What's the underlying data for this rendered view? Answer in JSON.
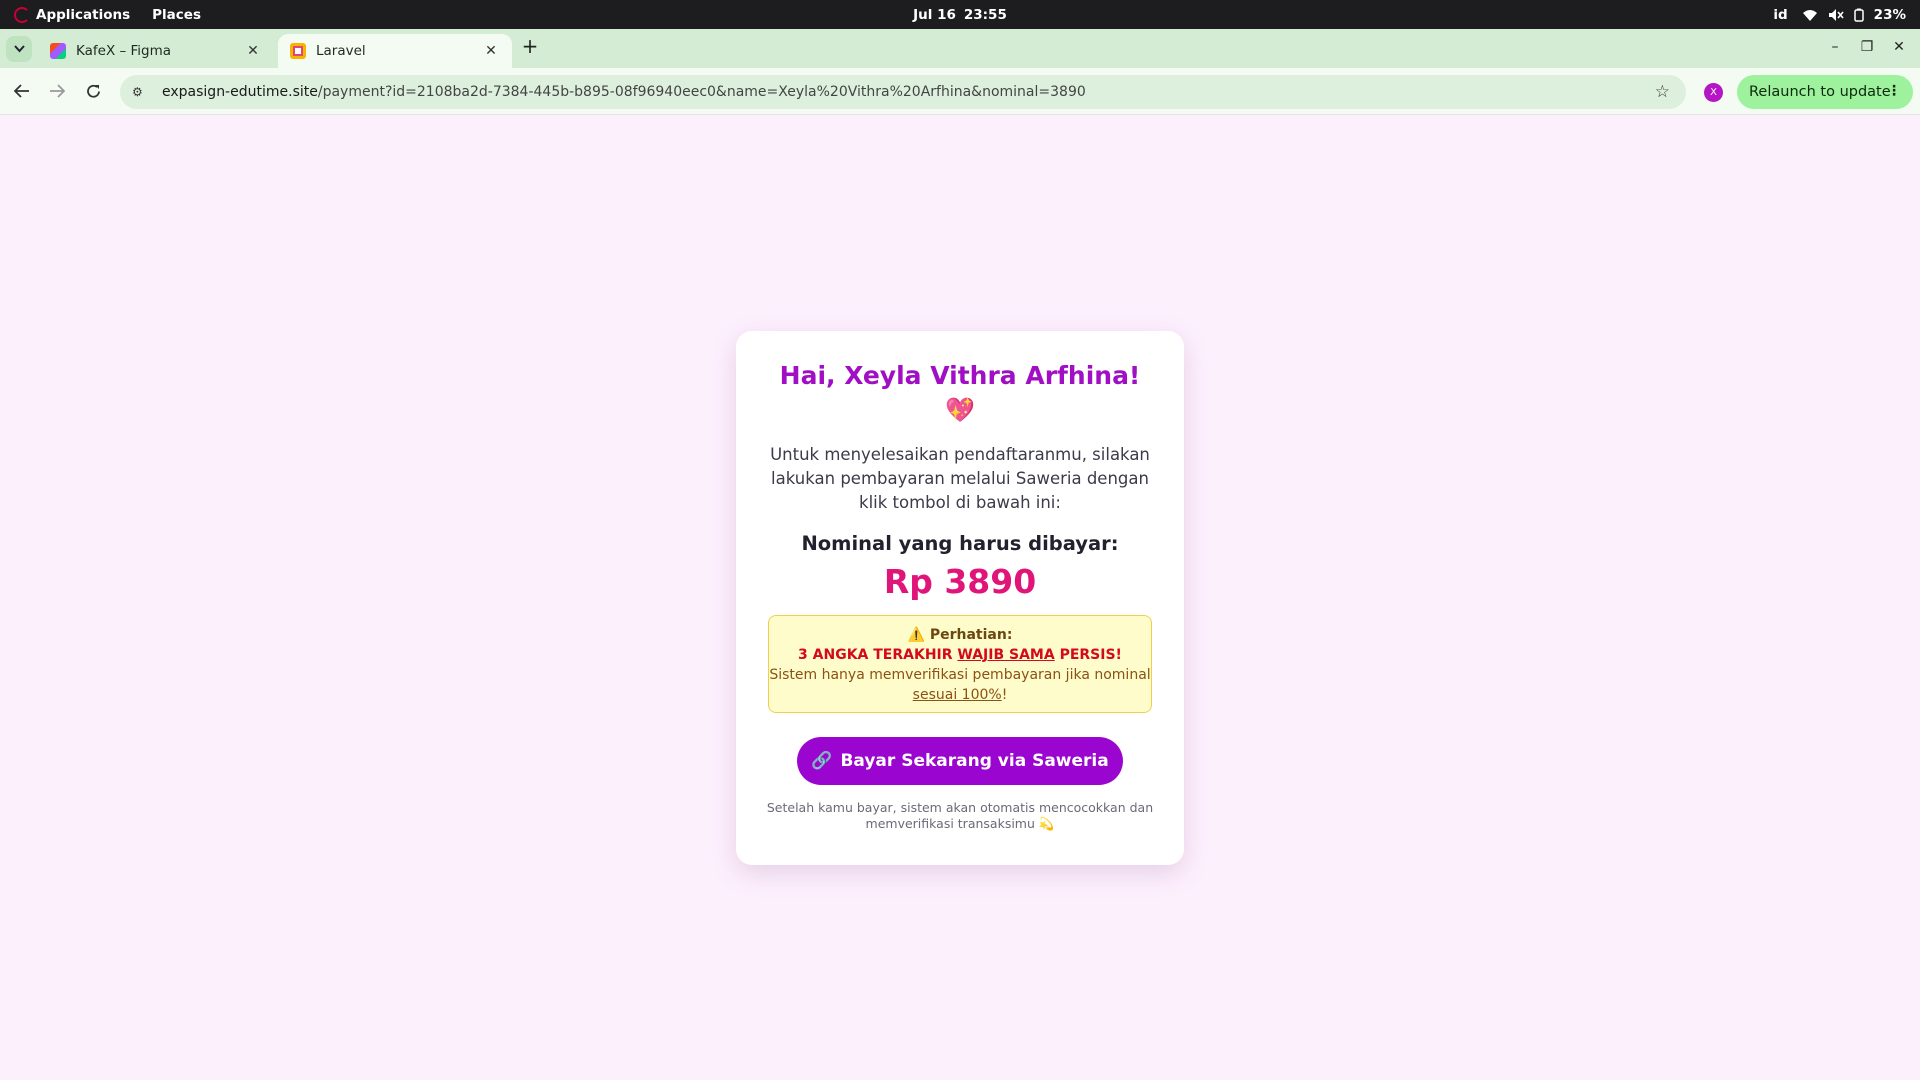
{
  "system": {
    "applications": "Applications",
    "places": "Places",
    "date": "Jul 16",
    "time": "23:55",
    "lang": "id",
    "battery": "23%"
  },
  "browser": {
    "tabs": [
      {
        "title": "KafeX – Figma"
      },
      {
        "title": "Laravel"
      }
    ],
    "url_host": "expasign-edutime.site",
    "url_path": "/payment?id=2108ba2d-7384-445b-b895-08f96940eec0&name=Xeyla%20Vithra%20Arfhina&nominal=3890",
    "profile_initial": "X",
    "relaunch_label": "Relaunch to update"
  },
  "page": {
    "greeting": "Hai, Xeyla Vithra Arfhina!",
    "greeting_emoji": "💖",
    "intro": "Untuk menyelesaikan pendaftaranmu, silakan lakukan pembayaran melalui Saweria dengan klik tombol di bawah ini:",
    "nominal_label": "Nominal yang harus dibayar:",
    "amount": "Rp 3890",
    "warning": {
      "title": "⚠️ Perhatian:",
      "alert_prefix": "3 ANGKA TERAKHIR ",
      "alert_emphasis": "WAJIB SAMA",
      "alert_suffix": " PERSIS!",
      "body_prefix": "Sistem hanya memverifikasi pembayaran jika nominal ",
      "body_emphasis": "sesuai 100%",
      "body_suffix": "!"
    },
    "pay_button": "Bayar Sekarang via Saweria",
    "pay_button_icon": "🔗",
    "footnote": "Setelah kamu bayar, sistem akan otomatis mencocokkan dan memverifikasi transaksimu 💫"
  }
}
